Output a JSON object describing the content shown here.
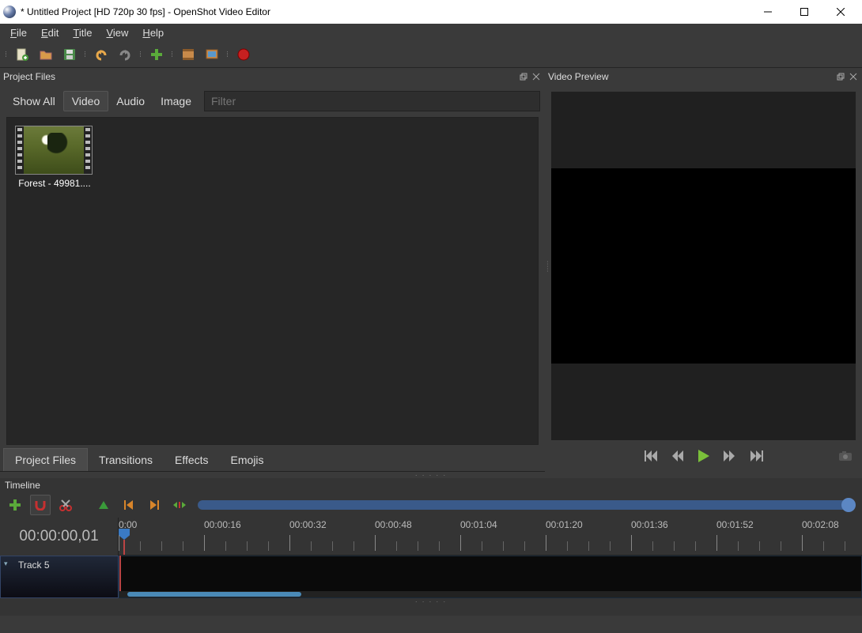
{
  "window": {
    "title": "* Untitled Project [HD 720p 30 fps] - OpenShot Video Editor"
  },
  "menu": {
    "items": [
      "File",
      "Edit",
      "Title",
      "View",
      "Help"
    ],
    "underline": [
      0,
      0,
      0,
      0,
      0
    ]
  },
  "toolbar_icons": [
    "new-project",
    "open-project",
    "save-project",
    "undo",
    "redo",
    "import-files",
    "profile",
    "fullscreen",
    "export"
  ],
  "project_files": {
    "panel_title": "Project Files",
    "tabs": [
      "Show All",
      "Video",
      "Audio",
      "Image"
    ],
    "active_tab": 1,
    "filter_placeholder": "Filter",
    "items": [
      {
        "label": "Forest - 49981...."
      }
    ]
  },
  "lower_tabs": {
    "items": [
      "Project Files",
      "Transitions",
      "Effects",
      "Emojis"
    ],
    "active": 0
  },
  "video_preview": {
    "title": "Video Preview"
  },
  "timeline": {
    "title": "Timeline",
    "timecode": "00:00:00,01",
    "ruler_labels": [
      "0:00",
      "00:00:16",
      "00:00:32",
      "00:00:48",
      "00:01:04",
      "00:01:20",
      "00:01:36",
      "00:01:52",
      "00:02:08"
    ],
    "track_name": "Track 5"
  }
}
